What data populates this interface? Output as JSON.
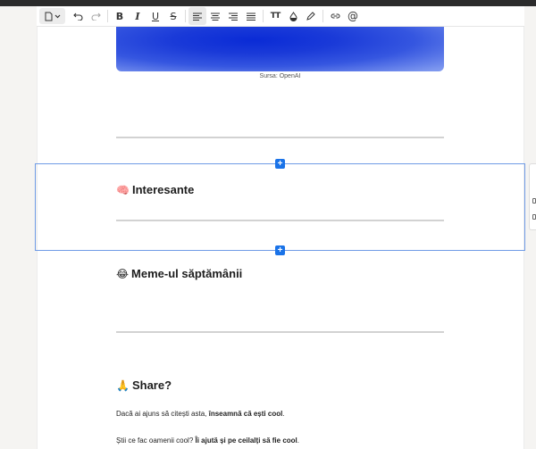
{
  "toolbar": {
    "buttons": [
      "page-format",
      "undo",
      "redo",
      "bold",
      "italic",
      "underline",
      "strikethrough",
      "align-left",
      "align-center",
      "align-right",
      "align-justify",
      "text-size",
      "text-color",
      "highlight",
      "link",
      "mention"
    ],
    "bold_label": "B",
    "italic_label": "I",
    "underline_label": "U",
    "strike_label": "S",
    "text_size_label": "TT",
    "mention_label": "@"
  },
  "hero": {
    "caption": "Sursa: OpenAI"
  },
  "section_interesante": {
    "emoji": "🧠",
    "title": "Interesante"
  },
  "section_meme": {
    "emoji": "😂",
    "title": "Meme-ul săptămânii"
  },
  "section_share": {
    "emoji": "🙏",
    "title": "Share?",
    "para1_prefix": "Dacă ai ajuns să citești asta, ",
    "para1_bold": "înseamnă că ești cool",
    "para1_suffix": ".",
    "para2_prefix": "Știi ce fac oamenii cool? ",
    "para2_bold": "Îi ajută și pe ceilalți să fie cool",
    "para2_suffix": "."
  },
  "insert_block_label": "+",
  "colors": {
    "accent": "#1a73e8",
    "selection_border": "#6f9be6"
  }
}
